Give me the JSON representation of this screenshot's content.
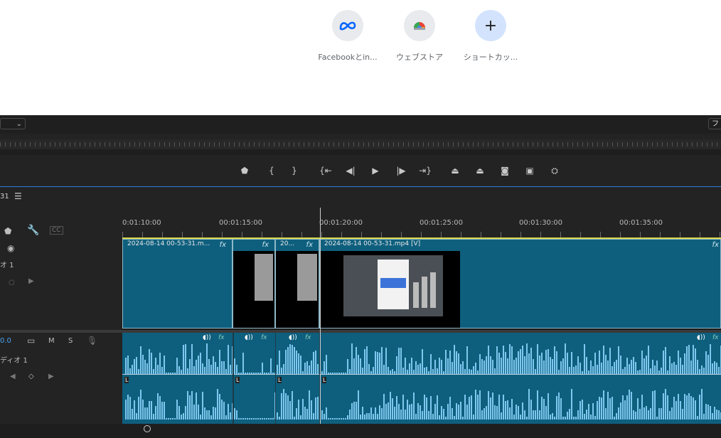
{
  "shortcuts": [
    {
      "label": "Facebookとin...",
      "icon": "meta-icon"
    },
    {
      "label": "ウェブストア",
      "icon": "chrome-web-store-icon"
    },
    {
      "label": "ショートカッ...",
      "icon": "add-icon"
    }
  ],
  "panel": {
    "right_menu_label": "フ",
    "sequence_name": "31",
    "timecodes": [
      "0:01:10:00",
      "00:01:15:00",
      "00:01:20:00",
      "00:01:25:00",
      "00:01:30:00",
      "00:01:35:00"
    ],
    "video_track_label": "オ 1",
    "audio_track_label": "ディオ 1",
    "audio_volume": "0.0",
    "mute_label": "M",
    "solo_label": "S"
  },
  "clips": {
    "video": [
      {
        "name": "2024-08-14 00-53-31.m...",
        "fx": "fx"
      },
      {
        "name": "",
        "fx": "fx"
      },
      {
        "name": "20...",
        "fx": "fx"
      },
      {
        "name": "2024-08-14 00-53-31.mp4 [V]",
        "fx": "fx"
      }
    ],
    "audio_fx": "fx",
    "audio_marker": "L"
  },
  "colors": {
    "clip": "#0e5f7e",
    "waveform": "#7ec8ef",
    "workarea": "#d8d84a",
    "accent": "#2b7fd8"
  }
}
